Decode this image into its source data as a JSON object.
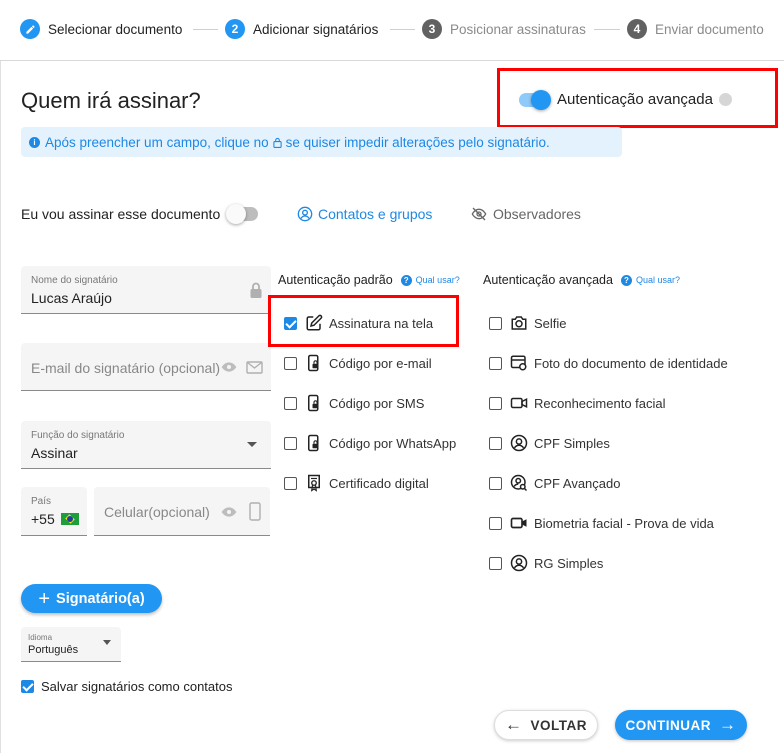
{
  "stepper": {
    "steps": [
      {
        "number": "1",
        "label": "Selecionar documento",
        "state": "done"
      },
      {
        "number": "2",
        "label": "Adicionar signatários",
        "state": "active"
      },
      {
        "number": "3",
        "label": "Posicionar assinaturas",
        "state": "pending"
      },
      {
        "number": "4",
        "label": "Enviar documento",
        "state": "pending"
      }
    ]
  },
  "header": {
    "title": "Quem irá assinar?",
    "advanced_auth_label": "Autenticação avançada",
    "advanced_auth_enabled": true
  },
  "info_banner": {
    "text_before": "Após preencher um campo, clique no",
    "text_after": "se quiser impedir alterações pelo signatário."
  },
  "self_sign": {
    "label": "Eu vou assinar esse documento",
    "enabled": false
  },
  "tabs": {
    "contacts": "Contatos e grupos",
    "observers": "Observadores"
  },
  "form": {
    "name": {
      "label": "Nome do signatário",
      "value": "Lucas Araújo"
    },
    "email": {
      "placeholder": "E-mail do signatário (opcional)"
    },
    "role": {
      "label": "Função do signatário",
      "value": "Assinar"
    },
    "country": {
      "label": "País",
      "value": "+55"
    },
    "phone": {
      "placeholder": "Celular(opcional)"
    }
  },
  "standard_auth": {
    "title": "Autenticação padrão",
    "help": "Qual usar?",
    "options": [
      {
        "label": "Assinatura na tela",
        "checked": true,
        "icon": "edit-icon"
      },
      {
        "label": "Código por e-mail",
        "checked": false,
        "icon": "phone-lock-icon"
      },
      {
        "label": "Código por SMS",
        "checked": false,
        "icon": "phone-lock-icon"
      },
      {
        "label": "Código por WhatsApp",
        "checked": false,
        "icon": "phone-lock-icon"
      },
      {
        "label": "Certificado digital",
        "checked": false,
        "icon": "certificate-icon"
      }
    ]
  },
  "advanced_auth": {
    "title": "Autenticação avançada",
    "help": "Qual usar?",
    "options": [
      {
        "label": "Selfie",
        "checked": false,
        "icon": "camera-icon"
      },
      {
        "label": "Foto do documento de identidade",
        "checked": false,
        "icon": "id-card-icon"
      },
      {
        "label": "Reconhecimento facial",
        "checked": false,
        "icon": "video-icon"
      },
      {
        "label": "CPF Simples",
        "checked": false,
        "icon": "person-circle-icon"
      },
      {
        "label": "CPF Avançado",
        "checked": false,
        "icon": "person-search-icon"
      },
      {
        "label": "Biometria facial - Prova de vida",
        "checked": false,
        "icon": "video-camera-icon"
      },
      {
        "label": "RG Simples",
        "checked": false,
        "icon": "person-circle-icon"
      }
    ]
  },
  "actions": {
    "add_signer": "Signatário(a)",
    "language_label": "Idioma",
    "language_value": "Português",
    "save_contacts_label": "Salvar signatários como contatos",
    "save_contacts_checked": true,
    "back": "VOLTAR",
    "continue": "CONTINUAR"
  },
  "colors": {
    "primary": "#2196f3",
    "highlight": "#ff0000",
    "banner_bg": "#e3f2fd"
  }
}
